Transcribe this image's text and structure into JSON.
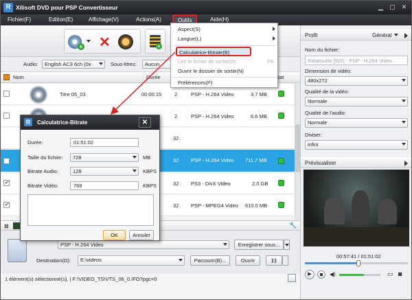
{
  "app": {
    "title": "Xilisoft DVD pour PSP Convertisseur"
  },
  "menubar": [
    "Fichier(F)",
    "Edition(E)",
    "Affichage(V)",
    "Actions(A)",
    "Outils",
    "Aide(H)"
  ],
  "audio_bar": {
    "audio_label": "Audio:",
    "audio_value": "English AC3 6ch (0x",
    "subs_label": "Sous-titres:",
    "subs_value": "Aucun"
  },
  "file_header": {
    "name": "Nom",
    "duration": "Durée",
    "ch": "Ch",
    "status": "tat"
  },
  "rows": [
    {
      "title": "Titre 05_03",
      "duration": "00:00:15",
      "ch": "2",
      "profile": "PSP - H.264 Video",
      "size": "3.7 MB",
      "checked": false
    },
    {
      "title": "",
      "duration": "",
      "ch": "2",
      "profile": "PSP - H.264 Video",
      "size": "6.6 MB",
      "checked": false
    },
    {
      "title": "",
      "duration": "",
      "ch": "32",
      "profile": "",
      "size": "",
      "checked": false
    },
    {
      "title": "",
      "duration": "",
      "ch": "32",
      "profile": "PSP - H.264 Video",
      "size": "711.7 MB",
      "checked": false
    },
    {
      "title": "",
      "duration": "",
      "ch": "32",
      "profile": "PS3 - DivX Video",
      "size": "2.0 GB",
      "checked": true
    },
    {
      "title": "",
      "duration": "",
      "ch": "32",
      "profile": "PSP - MPEG4 Video",
      "size": "610.0 MB",
      "checked": true
    }
  ],
  "bottom": {
    "profile_value": "PSP - H.264 Video",
    "save_as": "Enregistrer sous...",
    "dest_label": "Destination(D):",
    "dest_value": "E:\\videos",
    "browse": "Parcourir(B)...",
    "open": "Ouvrir"
  },
  "status": {
    "text": "1 élément(s) sélectionné(s). | F:\\VIDEO_TS\\VTS_06_0.IFO?pgc=0"
  },
  "right_panel": {
    "profile_label": "Profil",
    "general_label": "Général",
    "filename_label": "Nom du fichier:",
    "filename_value": "Ratatouille [WS] - PSP - H.264 Video",
    "dimension_label": "Dimension de vidéo:",
    "dimension_value": "480x272",
    "video_quality_label": "Qualité de la vidéo:",
    "video_quality_value": "Normale",
    "audio_quality_label": "Qualité de l'audio:",
    "audio_quality_value": "Normale",
    "split_label": "Diviser:",
    "split_value": "infini",
    "preview_label": "Prévisualiser",
    "time": "00:57:41 / 01:51:02",
    "progress": 0.52,
    "volume": 0.6
  },
  "tools_menu": {
    "items": [
      "Aspect(S)",
      "Langue(L)",
      "Calculatrice-Bitrate(B)",
      "Lire le fichier de sortie(O)",
      "Ouvrir le dossier de sortie(N)",
      "Préférences(P)"
    ],
    "shortcut": "F8"
  },
  "dialog": {
    "title": "Calculatrice-Bitrate",
    "duration_label": "Durée:",
    "duration_value": "01:51:02",
    "filesize_label": "Taille du fichier:",
    "filesize_value": "728",
    "filesize_unit": "MB",
    "audio_label": "Bitrate Audio:",
    "audio_value": "128",
    "audio_unit": "KBPS",
    "video_label": "Bitrate Vidéo:",
    "video_value": "768",
    "video_unit": "KBPS",
    "ok": "OK",
    "cancel": "Annuler"
  },
  "colors": {
    "selected_row": "#29a3e3",
    "status_ok": "#2ec42e",
    "highlight": "#e02020"
  }
}
